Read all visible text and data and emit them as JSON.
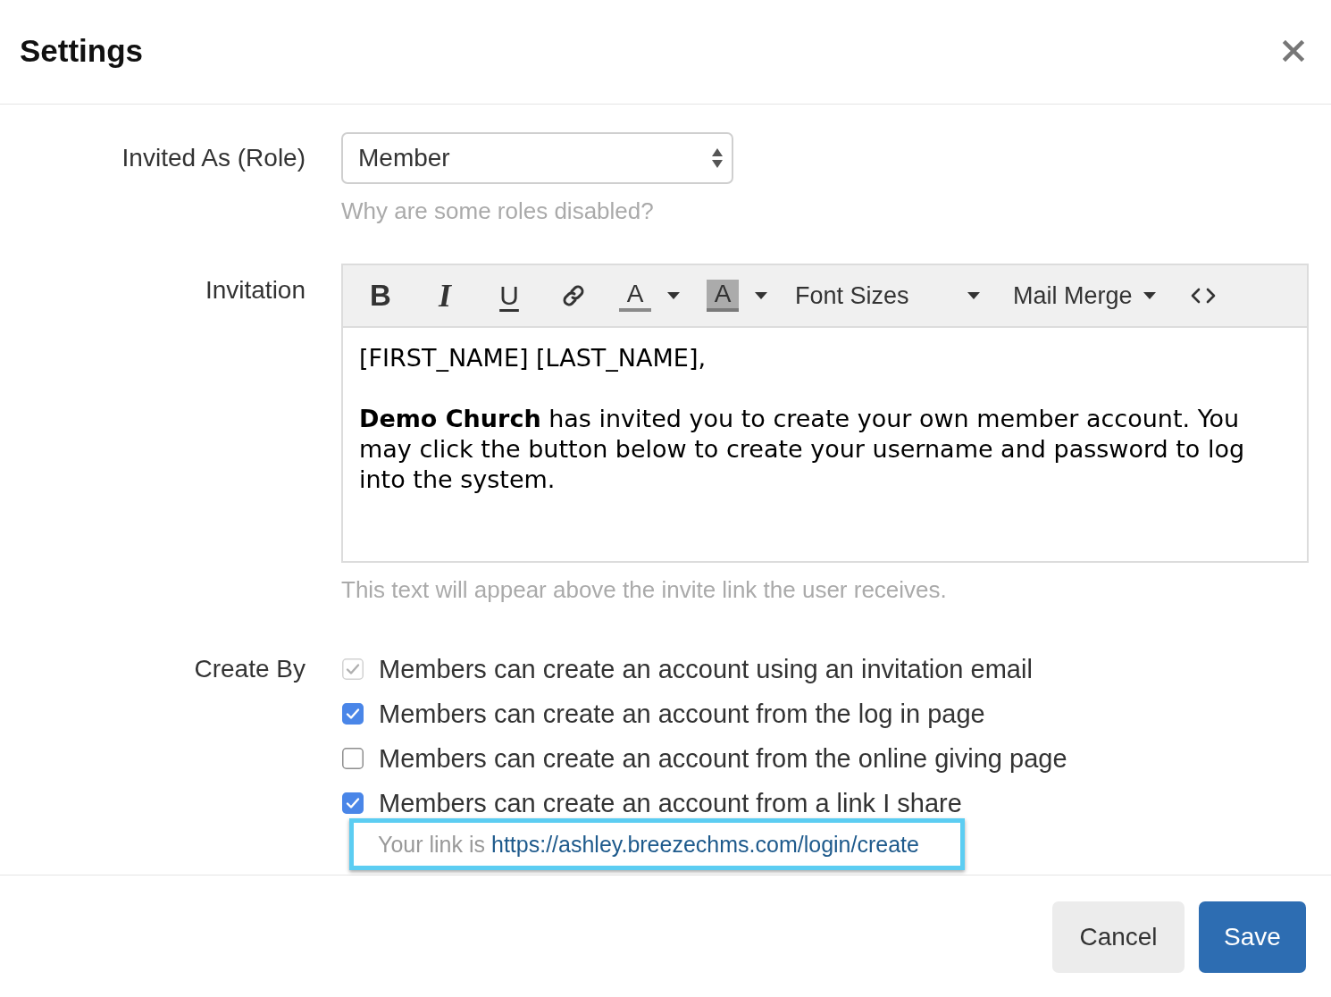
{
  "dialog": {
    "title": "Settings"
  },
  "role_field": {
    "label": "Invited As (Role)",
    "value": "Member",
    "help": "Why are some roles disabled?"
  },
  "invitation": {
    "label": "Invitation",
    "toolbar": [
      {
        "kind": "bold",
        "label": "B"
      },
      {
        "kind": "italic",
        "label": "I"
      },
      {
        "kind": "underline",
        "label": "U"
      },
      {
        "kind": "link"
      },
      {
        "kind": "font-color",
        "label": "A"
      },
      {
        "kind": "highlight-color",
        "label": "A"
      },
      {
        "kind": "size-select",
        "label": "Font Sizes"
      },
      {
        "kind": "menu",
        "label": "Mail Merge"
      },
      {
        "kind": "code-view"
      }
    ],
    "paragraphs": [
      "[FIRST_NAME] [LAST_NAME],",
      "**Demo Church** has invited you to create your own member account. You may click the button below to create your username and password to log into the system."
    ],
    "help": "This text will appear above the invite link the user receives."
  },
  "create_by": {
    "label": "Create By",
    "options": [
      {
        "label": "Members can create an account using an invitation email",
        "checked": true,
        "disabled": true
      },
      {
        "label": "Members can create an account from the log in page",
        "checked": true,
        "disabled": false
      },
      {
        "label": "Members can create an account from the online giving page",
        "checked": false,
        "disabled": false
      },
      {
        "label": "Members can create an account from a link I share",
        "checked": true,
        "disabled": false
      }
    ],
    "link_note": {
      "text": "Your link is",
      "link": "https://ashley.breezechms.com/login/create",
      "highlighted": true
    }
  },
  "buttons": [
    {
      "kind": "secondary",
      "label": "Cancel"
    },
    {
      "kind": "primary",
      "label": "Save"
    }
  ]
}
